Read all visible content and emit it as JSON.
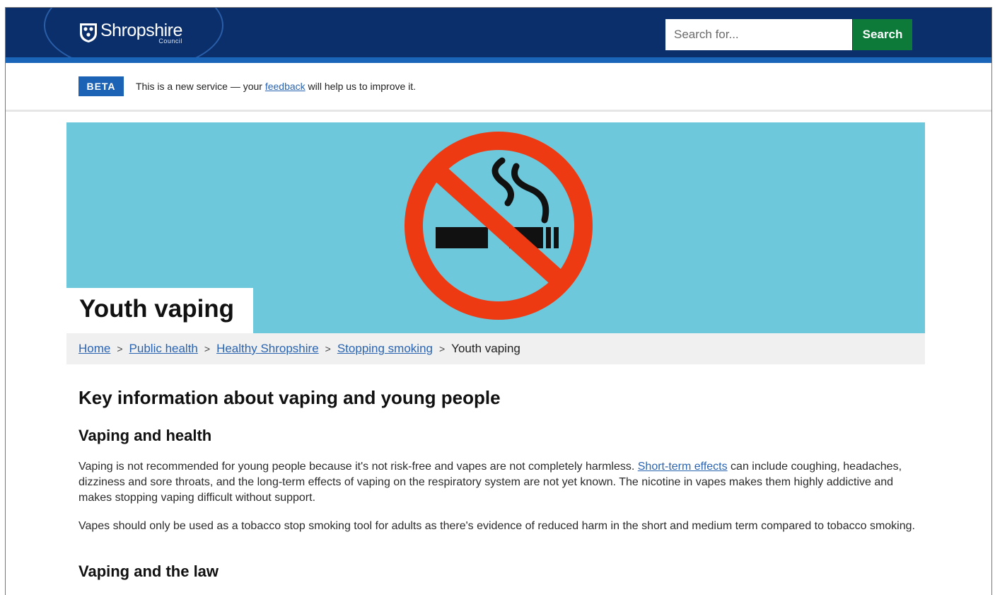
{
  "header": {
    "logo_name": "Shropshire",
    "logo_sub": "Council",
    "search_placeholder": "Search for...",
    "search_button": "Search"
  },
  "beta": {
    "tag": "BETA",
    "text_before": "This is a new service — your ",
    "link": "feedback",
    "text_after": " will help us to improve it."
  },
  "hero": {
    "title": "Youth vaping",
    "icon": "no-smoking-icon"
  },
  "breadcrumb": {
    "items": [
      "Home",
      "Public health",
      "Healthy Shropshire",
      "Stopping smoking"
    ],
    "current": "Youth vaping",
    "separator": ">"
  },
  "content": {
    "heading": "Key information about vaping and young people",
    "section1_title": "Vaping and health",
    "para1_before": "Vaping is not recommended for young people because it's not risk-free and vapes are not completely harmless. ",
    "para1_link": "Short-term effects",
    "para1_after": " can include coughing, headaches, dizziness and sore throats, and the long-term effects of vaping on the respiratory system are not yet known. The nicotine in vapes makes them highly addictive and makes stopping vaping difficult without support.",
    "para2": "Vapes should only be used as a tobacco stop smoking tool for adults as there's evidence of reduced harm in the short and medium term compared to tobacco smoking.",
    "section2_title": "Vaping and the law"
  },
  "colors": {
    "header_bg": "#0b2f6b",
    "search_button_bg": "#0e7a3a",
    "beta_bg": "#1c63b5",
    "hero_bg": "#6ec8dc",
    "no_smoking_red": "#ee3a12",
    "link": "#2a64b0"
  }
}
